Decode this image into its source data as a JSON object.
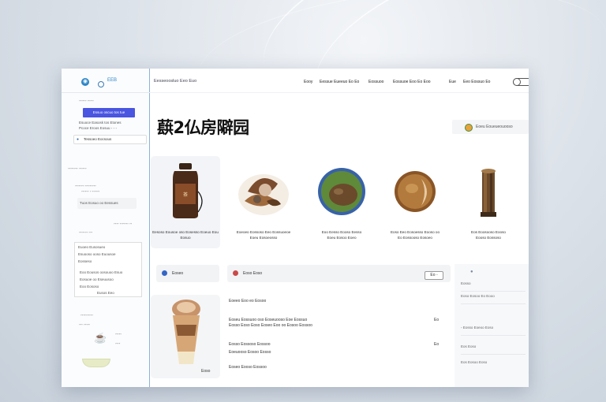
{
  "sidebar": {
    "brand": "ЕЕВ",
    "lines": [
      "◦◦◦◦◦◦  ◦◦◦◦◦",
      "Esuoce Easosk tos Etones",
      "Pcoce Eroos Eosuu ◦ ◦ ◦",
      "◦◦◦◦◦◦◦◦ ◦◦◦◦◦◦",
      "◦◦◦◦◦◦◦ ◦◦◦◦◦◦◦◦◦",
      "◦◦◦◦◦◦ ◦ ◦◦◦◦◦◦",
      "◦◦◦◦ ◦◦◦◦◦◦◦ ◦◦",
      "◦◦◦◦◦◦◦ ◦◦◦",
      "◦◦◦◦◦◦◦◦◦◦"
    ],
    "button_label": "Essuo oscuo tos tue",
    "search_label": "Tessoeo Eocsous",
    "box_label": "Tuos Eosuo oo Eessues",
    "panel_items": [
      "Euoeo Eusosueo",
      "Esuooso ooso Euousoe",
      "Eosseso",
      "Eoo Eousos oosouoo Esuo",
      "Eosuoe oo Eseuusoo",
      "Eoo Eososo",
      "Eusos Eeo"
    ],
    "bottom_labels": [
      "◦◦◦ ◦◦◦◦◦",
      "◦◦◦◦◦",
      "◦◦◦◦"
    ]
  },
  "topbar": {
    "brand": "Eesseoosluo  Eeo Euo",
    "nav": [
      "Eooy",
      "Eessue Eueeuo Eo Eo",
      "Eossuoo",
      "Eossuoe Eoo Eo Eoo",
      "Eue",
      "Eeo Eossuo Eo"
    ]
  },
  "page": {
    "title": "蕻2仏房隦园",
    "filter_label": "Eoeu  Eoueueouooso"
  },
  "products": [
    {
      "name": "Eesoso Eousoe oso Eosesso Eoeuo Eou\nEosuo",
      "icon": "bottle"
    },
    {
      "name": "Eoeoeo Eossoso Eeo Eossuoeoe\nEoeu Eosoeosso",
      "icon": "mushroom-dish"
    },
    {
      "name": "Eoo Eesso Eooso Eesso\nEoeu Eosoo Eoeo",
      "icon": "round-dish"
    },
    {
      "name": "Eoso Eeo Eosoesso Eooso oo\nEo Eossooso Eosoeo",
      "icon": "brown-fruit"
    },
    {
      "name": "Eos Eoosooso Eooso\nEooso Eossoso",
      "icon": "tree-stump"
    }
  ],
  "rows": [
    {
      "label": "Eoseo",
      "color": "#3465c6"
    },
    {
      "label": "Eoso Eoso",
      "color": "#c94a4a"
    }
  ],
  "stepper_label": "Eo ◦",
  "list": {
    "lines": [
      "Eoeeo Eoo eo Eosoo",
      "Eoseu Eossuoo oso Eoseuooso Eoe Eossuo",
      "Eosso Eoso Eoso Eoseo Eoo oo Eosoo Eossoo",
      "Eosso Eossoso Eossoo",
      "Eoeuooso Eosoo Eosso",
      "Eoseo Eooso Eossoo"
    ],
    "nums": [
      "Eo",
      "Eo"
    ]
  },
  "right_panel": {
    "lines": [
      "Eosso",
      "Eoso Eosoo Eo Eooo",
      "◦ Eosso Eoeoo Eoso",
      "Eos Eoso",
      "Eos Eosoo Eoso"
    ]
  },
  "bottom_card": {
    "label": "Eoso"
  },
  "colors": {
    "accent": "#4a55e0",
    "sidebar_border": "#8fb0dd"
  }
}
